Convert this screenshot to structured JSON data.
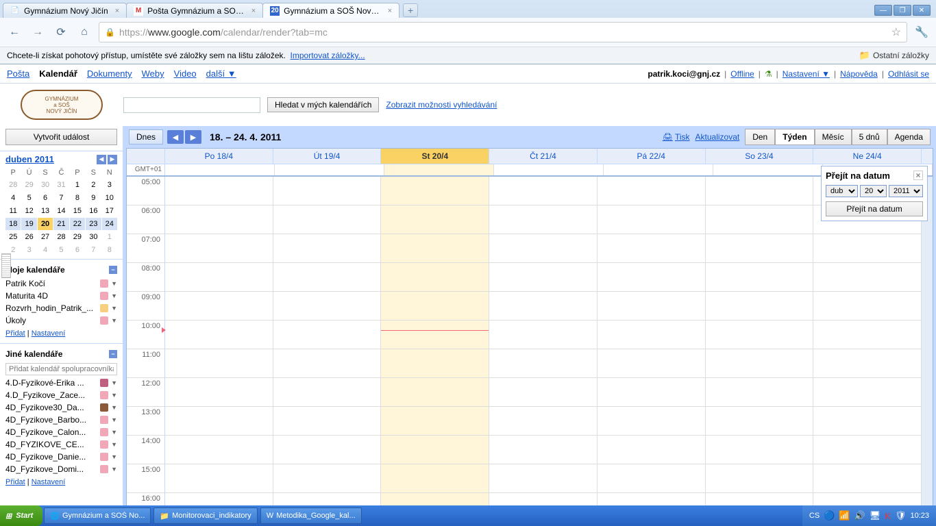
{
  "browser": {
    "tabs": [
      {
        "icon": "📄",
        "label": "Gymnázium Nový Jičín"
      },
      {
        "icon": "M",
        "label": "Pošta Gymnázium a SOŠ N..."
      },
      {
        "icon": "20",
        "label": "Gymnázium a SOŠ Nový Jičí..."
      }
    ],
    "url_prefix": "https://",
    "url_host": "www.google.com",
    "url_path": "/calendar/render?tab=mc",
    "bookmark_hint": "Chcete-li získat pohotový přístup, umístěte své záložky sem na lištu záložek.",
    "import_link": "Importovat záložky...",
    "other_bookmarks": "Ostatní záložky"
  },
  "google_nav": {
    "items": [
      "Pošta",
      "Kalendář",
      "Dokumenty",
      "Weby",
      "Video",
      "další ▼"
    ],
    "active_index": 1,
    "user_email": "patrik.koci@gnj.cz",
    "links": [
      "Offline",
      "Nastavení ▼",
      "Nápověda",
      "Odhlásit se"
    ],
    "labs_icon": "⚗"
  },
  "search": {
    "logo_line1": "GYMNÁZIUM",
    "logo_line2": "a SOŠ",
    "logo_line3": "NOVÝ JIČÍN",
    "button": "Hledat v mých kalendářích",
    "options": "Zobrazit možnosti vyhledávání"
  },
  "sidebar": {
    "create": "Vytvořit událost",
    "month_title": "duben 2011",
    "dow": [
      "P",
      "Ú",
      "S",
      "Č",
      "P",
      "S",
      "N"
    ],
    "weeks": [
      [
        {
          "n": 28,
          "o": 1
        },
        {
          "n": 29,
          "o": 1
        },
        {
          "n": 30,
          "o": 1
        },
        {
          "n": 31,
          "o": 1
        },
        {
          "n": 1
        },
        {
          "n": 2
        },
        {
          "n": 3
        }
      ],
      [
        {
          "n": 4
        },
        {
          "n": 5
        },
        {
          "n": 6
        },
        {
          "n": 7
        },
        {
          "n": 8
        },
        {
          "n": 9
        },
        {
          "n": 10
        }
      ],
      [
        {
          "n": 11
        },
        {
          "n": 12
        },
        {
          "n": 13
        },
        {
          "n": 14
        },
        {
          "n": 15
        },
        {
          "n": 16
        },
        {
          "n": 17
        }
      ],
      [
        {
          "n": 18,
          "w": 1
        },
        {
          "n": 19,
          "w": 1
        },
        {
          "n": 20,
          "t": 1
        },
        {
          "n": 21,
          "w": 1
        },
        {
          "n": 22,
          "w": 1
        },
        {
          "n": 23,
          "w": 1
        },
        {
          "n": 24,
          "w": 1
        }
      ],
      [
        {
          "n": 25
        },
        {
          "n": 26
        },
        {
          "n": 27
        },
        {
          "n": 28
        },
        {
          "n": 29
        },
        {
          "n": 30
        },
        {
          "n": 1,
          "o": 1
        }
      ],
      [
        {
          "n": 2,
          "o": 1
        },
        {
          "n": 3,
          "o": 1
        },
        {
          "n": 4,
          "o": 1
        },
        {
          "n": 5,
          "o": 1
        },
        {
          "n": 6,
          "o": 1
        },
        {
          "n": 7,
          "o": 1
        },
        {
          "n": 8,
          "o": 1
        }
      ]
    ],
    "my_cal_title": "Moje kalendáře",
    "my_cals": [
      {
        "name": "Patrik Kočí",
        "color": "#f0a8b8"
      },
      {
        "name": "Maturita 4D",
        "color": "#f0a8b8"
      },
      {
        "name": "Rozvrh_hodin_Patrik_...",
        "color": "#f6d080"
      },
      {
        "name": "Úkoly",
        "color": "#f0a8b8"
      }
    ],
    "add_link": "Přidat",
    "settings_link": "Nastavení",
    "other_cal_title": "Jiné kalendáře",
    "add_placeholder": "Přidat kalendář spolupracovníka",
    "other_cals": [
      {
        "name": "4.D-Fyzikové-Erika ...",
        "color": "#c06080"
      },
      {
        "name": "4.D_Fyzikove_Zace...",
        "color": "#f0a8b8"
      },
      {
        "name": "4D_Fyzikove30_Da...",
        "color": "#8a5a3a"
      },
      {
        "name": "4D_Fyzikove_Barbo...",
        "color": "#f0a8b8"
      },
      {
        "name": "4D_Fyzikove_Calon...",
        "color": "#f0a8b8"
      },
      {
        "name": "4D_FYZIKOVE_CE...",
        "color": "#f0a8b8"
      },
      {
        "name": "4D_Fyzikove_Danie...",
        "color": "#f0a8b8"
      },
      {
        "name": "4D_Fyzikove_Domi...",
        "color": "#f0a8b8"
      }
    ]
  },
  "calendar": {
    "today_btn": "Dnes",
    "date_range": "18. – 24. 4. 2011",
    "print": "Tisk",
    "refresh": "Aktualizovat",
    "views": [
      "Den",
      "Týden",
      "Měsíc",
      "5 dnů",
      "Agenda"
    ],
    "active_view": 1,
    "gmt": "GMT+01",
    "day_headers": [
      "Po 18/4",
      "Út 19/4",
      "St 20/4",
      "Čt 21/4",
      "Pá 22/4",
      "So 23/4",
      "Ne 24/4"
    ],
    "today_index": 2,
    "hours": [
      "05:00",
      "06:00",
      "07:00",
      "08:00",
      "09:00",
      "10:00",
      "11:00",
      "12:00",
      "13:00",
      "14:00",
      "15:00",
      "16:00"
    ]
  },
  "goto": {
    "title": "Přejít na datum",
    "month": "dub",
    "day": "20",
    "year": "2011",
    "button": "Přejít na datum"
  },
  "taskbar": {
    "start": "Start",
    "items": [
      {
        "icon": "🌐",
        "label": "Gymnázium a SOŠ No..."
      },
      {
        "icon": "📁",
        "label": "Monitorovaci_indikatory"
      },
      {
        "icon": "W",
        "label": "Metodika_Google_kal..."
      }
    ],
    "lang": "CS",
    "time": "10:23"
  }
}
